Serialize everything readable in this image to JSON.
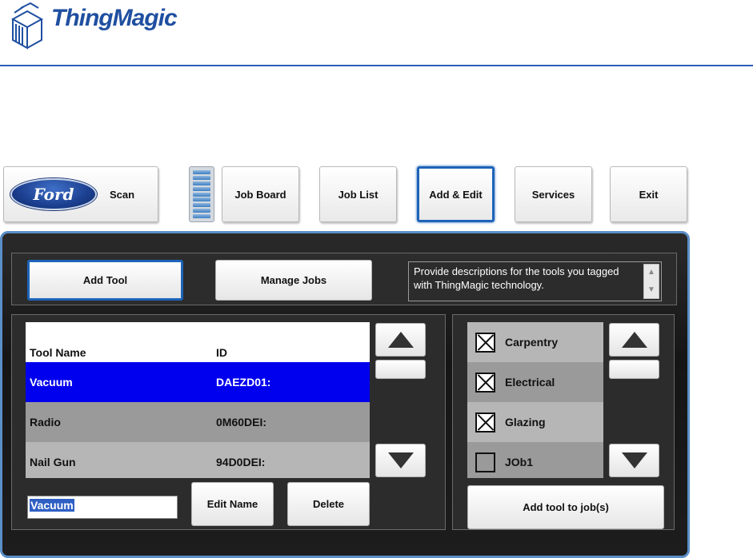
{
  "brand": {
    "name": "ThingMagic",
    "color": "#1f4fa0"
  },
  "nav": {
    "scan_logo": "Ford",
    "scan": "Scan",
    "job_board": "Job Board",
    "job_list": "Job List",
    "add_edit": "Add & Edit",
    "services": "Services",
    "exit": "Exit",
    "active": "Add & Edit"
  },
  "toolbar": {
    "add_tool": "Add Tool",
    "manage_jobs": "Manage Jobs",
    "description": "Provide descriptions for the tools you tagged with ThingMagic technology."
  },
  "tools": {
    "columns": [
      "Tool Name",
      "ID"
    ],
    "rows": [
      {
        "name": "Vacuum",
        "id": "DAEZD01:",
        "selected": true
      },
      {
        "name": "Radio",
        "id": "0M60DEI:",
        "selected": false
      },
      {
        "name": "Nail Gun",
        "id": "94D0DEI:",
        "selected": false
      }
    ],
    "edit_value": "Vacuum",
    "edit_name": "Edit Name",
    "delete": "Delete"
  },
  "jobs": {
    "items": [
      {
        "label": "Carpentry",
        "checked": true
      },
      {
        "label": "Electrical",
        "checked": true
      },
      {
        "label": "Glazing",
        "checked": true
      },
      {
        "label": "JOb1",
        "checked": false
      }
    ],
    "add_to_job": "Add tool to job(s)"
  },
  "icons": {
    "up": "arrow-up-icon",
    "down": "arrow-down-icon",
    "checkbox": "checkbox-icon",
    "logo": "thingmagic-logo-icon"
  },
  "colors": {
    "selection": "#0000ee",
    "accent": "#1e64b8"
  }
}
